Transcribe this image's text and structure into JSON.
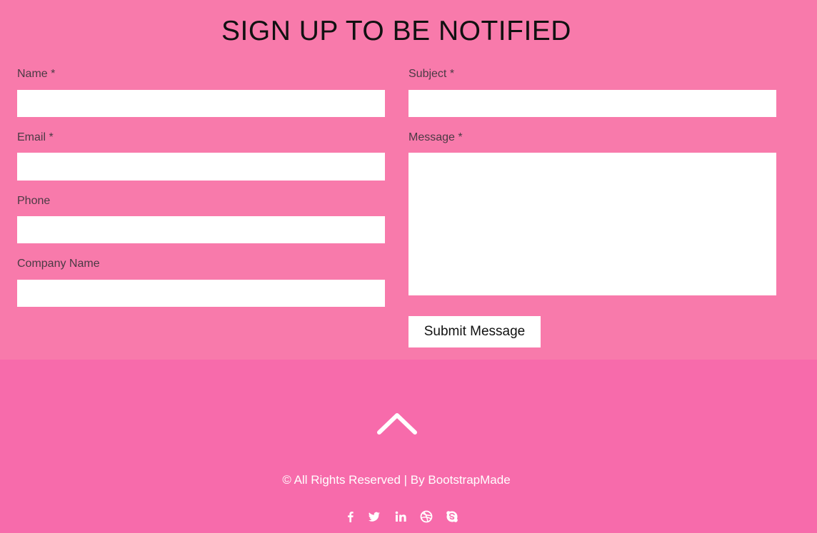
{
  "form": {
    "title": "SIGN UP TO BE NOTIFIED",
    "name_label": "Name *",
    "email_label": "Email *",
    "phone_label": "Phone",
    "company_label": "Company Name",
    "subject_label": "Subject *",
    "message_label": "Message *",
    "name_value": "",
    "email_value": "",
    "phone_value": "",
    "company_value": "",
    "subject_value": "",
    "message_value": "",
    "submit_label": "Submit Message"
  },
  "footer": {
    "copyright": "© All Rights Reserved | By BootstrapMade",
    "social_icons": [
      "facebook-icon",
      "twitter-icon",
      "linkedin-icon",
      "dribbble-icon",
      "skype-icon"
    ]
  },
  "colors": {
    "form_background": "#f87aab",
    "footer_background": "#f76bab",
    "input_background": "#ffffff"
  }
}
